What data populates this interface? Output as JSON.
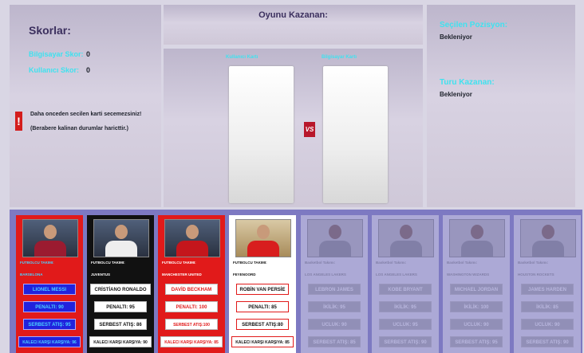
{
  "left_panel": {
    "title": "Skorlar:",
    "computer_score_label": "Bilgisayar Skor:",
    "computer_score_value": "0",
    "user_score_label": "Kullanıcı Skor:",
    "user_score_value": "0",
    "warning_line1": "Daha onceden secilen karti secemezsiniz!",
    "warning_line2": "(Berabere kalinan durumlar haricttir.)"
  },
  "center_panel": {
    "winner_title": "Oyunu Kazanan:",
    "user_card_label": "Kullanıcı Kartı",
    "computer_card_label": "Bilgisayar Kartı",
    "vs_label": "VS"
  },
  "right_panel": {
    "selected_position_label": "Seçilen Pozisyon:",
    "selected_position_value": "Bekleniyor",
    "round_winner_label": "Turu Kazanan:",
    "round_winner_value": "Bekleniyor"
  },
  "cards": [
    {
      "type_label": "FUTBOLCU TAKIMI:",
      "team": "BARSELONA",
      "name": "LIONEL MESSI",
      "stat1": "PENALTI: 90",
      "stat2": "SERBEST ATIŞ: 95",
      "stat3": "KALECI KARŞI KARŞIYA: 96"
    },
    {
      "type_label": "FUTBOLCU TAKIMI:",
      "team": "JUVENTUS",
      "name": "CRİSTİANO RONALDO",
      "stat1": "PENALTI: 95",
      "stat2": "SERBEST ATIŞ: 86",
      "stat3": "KALECI KARŞI KARŞIYA: 90"
    },
    {
      "type_label": "FUTBOLCU TAKIMI:",
      "team": "MANCHESTER UNITED",
      "name": "DAVİD BECKHAM",
      "stat1": "PENALTI: 100",
      "stat2": "SERBEST ATIŞ:100",
      "stat3": "KALECI KARŞI KARŞIYA: 85"
    },
    {
      "type_label": "FUTBOLCU TAKIMI:",
      "team": "FEYENOORD",
      "name": "ROBİN VAN PERSİE",
      "stat1": "PENALTI: 85",
      "stat2": "SERBEST ATIŞ:80",
      "stat3": "KALECI KARŞI KARŞIYA: 85"
    },
    {
      "type_label": "Basketbol Takımı:",
      "team": "LOS ANGELES LAKERS",
      "name": "LEBRON JAMES",
      "stat1": "İKİLİK: 95",
      "stat2": "UCLUK: 90",
      "stat3": "SERBEST ATIŞ: 85"
    },
    {
      "type_label": "Basketbol Takımı:",
      "team": "LOS ANGELES LAKERS",
      "name": "KOBE BRYANT",
      "stat1": "İKİLİK: 95",
      "stat2": "UCLUK: 95",
      "stat3": "SERBEST ATIŞ: 90"
    },
    {
      "type_label": "Basketbol Takımı:",
      "team": "WASHINGTON WIZARDS",
      "name": "MICHAEL JORDAN",
      "stat1": "İKİLİK: 100",
      "stat2": "UCLUK: 90",
      "stat3": "SERBEST ATIŞ: 95"
    },
    {
      "type_label": "Basketbol Takımı:",
      "team": "HOUSTON ROCKETS",
      "name": "JAMES HARDEN",
      "stat1": "İKİLİK: 85",
      "stat2": "UCLUK: 90",
      "stat3": "SERBEST ATIŞ: 90"
    }
  ]
}
